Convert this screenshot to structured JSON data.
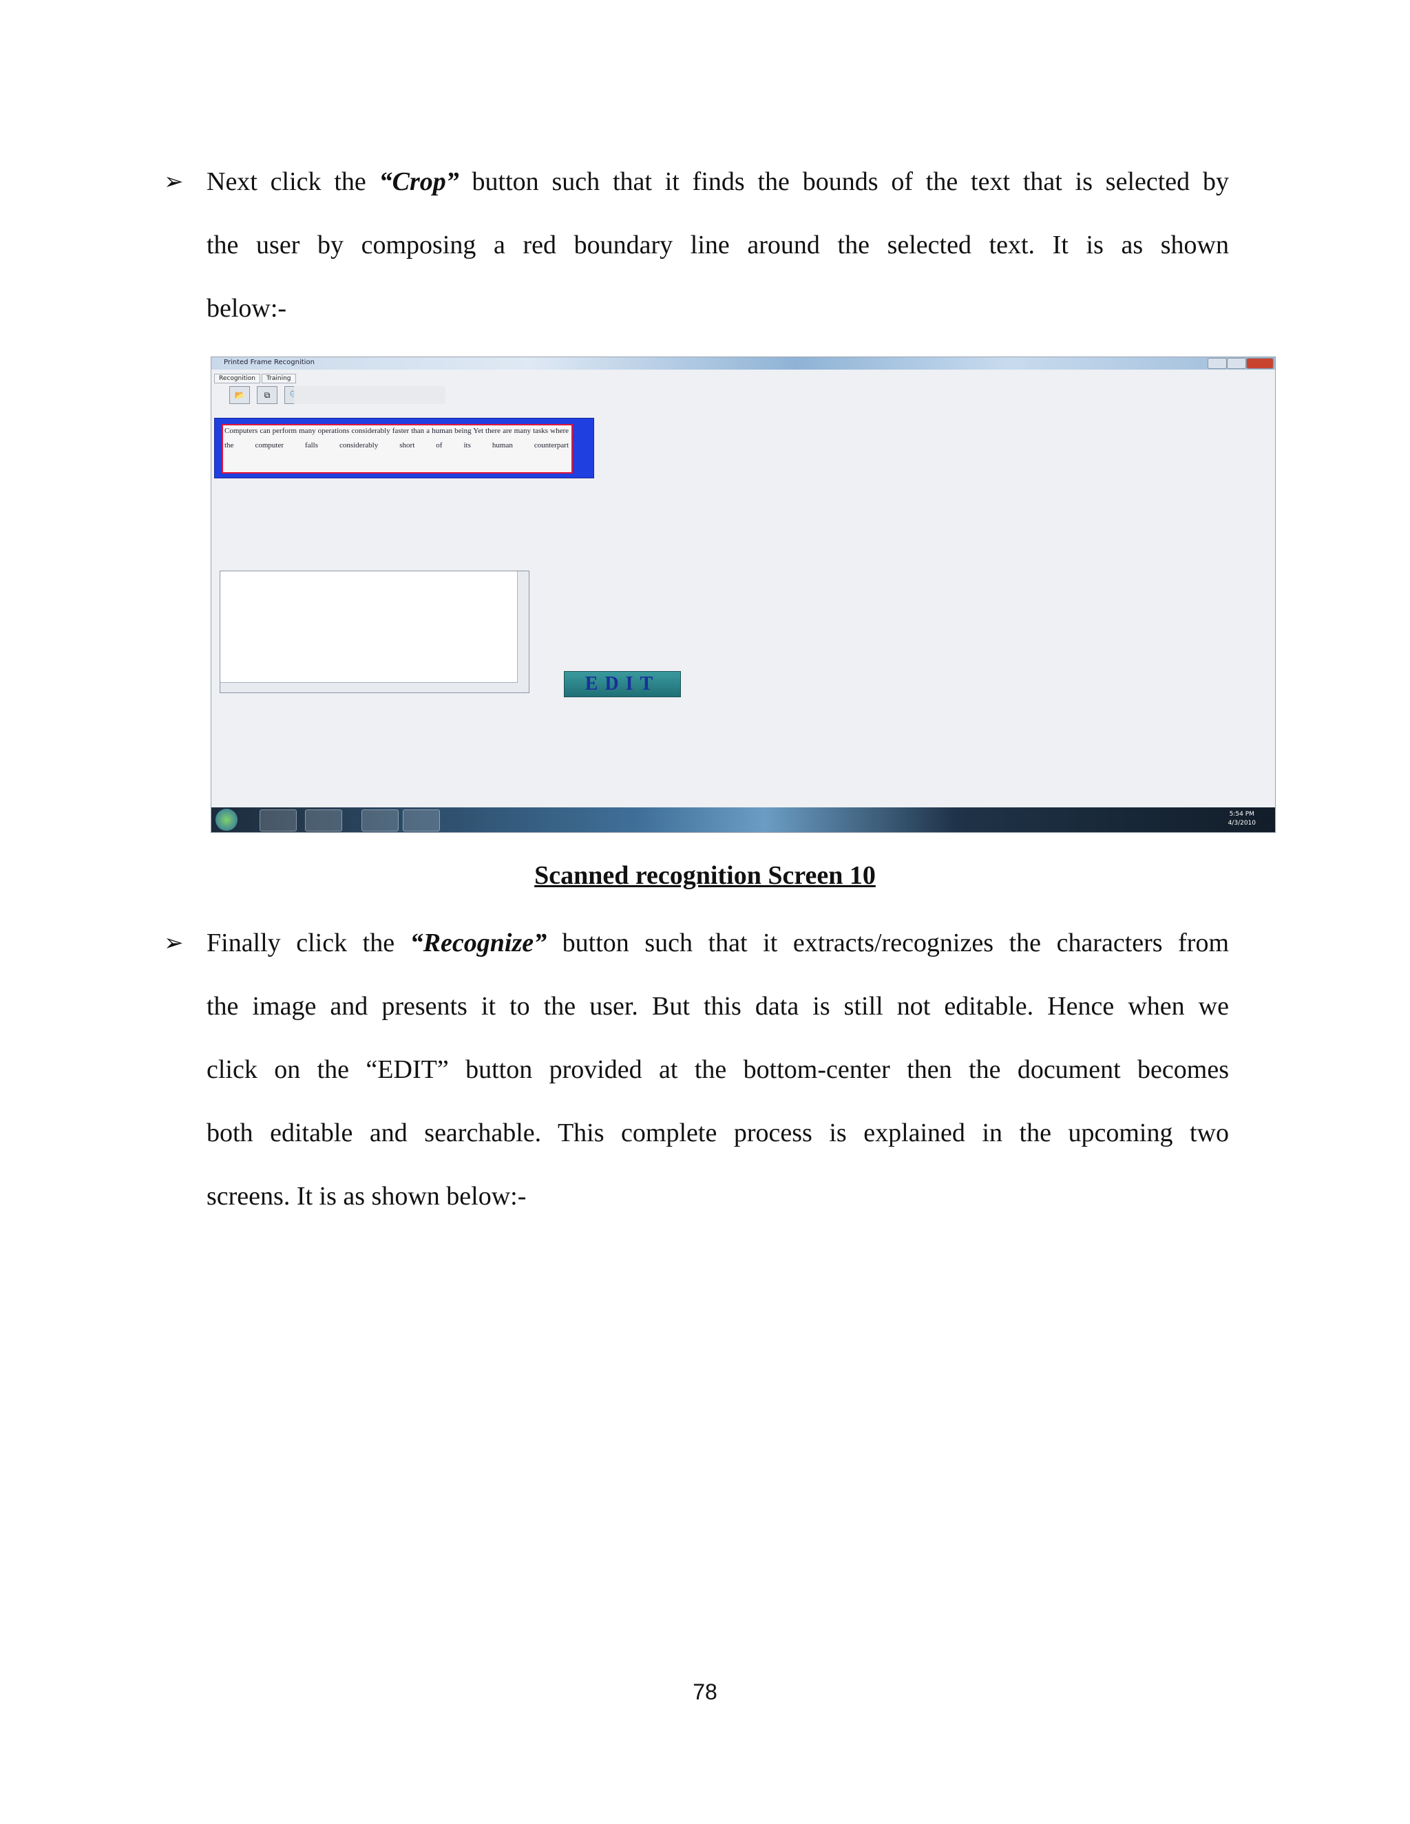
{
  "para1": {
    "pre": "Next click the ",
    "em": "“Crop”",
    "post": " button such that it finds the bounds of the text that is selected by",
    "line2": "the user by composing a red boundary line around the selected text. It is as shown",
    "line3": "below:-"
  },
  "screenshot": {
    "window_title": "Printed Frame Recognition",
    "tabs": [
      "Recognition",
      "Training"
    ],
    "selected_text": "Computers can perform many operations considerably faster than a human being Yet there are many tasks where the computer falls considerably short of its human counterpart",
    "edit_label": "EDIT",
    "clock_time": "5:54 PM",
    "clock_date": "4/3/2010"
  },
  "caption": "Scanned recognition Screen 10",
  "para2": {
    "pre": "Finally click the ",
    "em": "“Recognize”",
    "post": " button such that it extracts/recognizes the characters from",
    "line2": "the image and presents it to the user. But this data is still not editable. Hence when we",
    "line3": "click on the “EDIT” button provided at the bottom-center then the document becomes",
    "line4": "both editable and searchable. This complete process is explained in the upcoming two",
    "line5": "screens. It is as shown below:-"
  },
  "page_number": "78"
}
